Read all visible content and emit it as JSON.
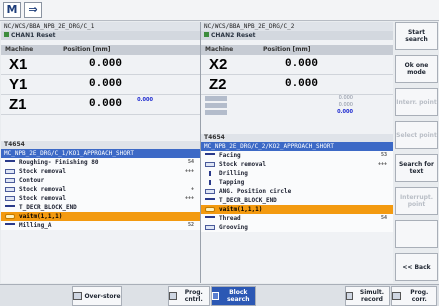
{
  "topbar": {
    "icon1": "M",
    "icon2": "⇒"
  },
  "channels": [
    {
      "path": "NC/WCS/BBA_NPB_2E_DRG/C_1",
      "status": "CHAN1 Reset",
      "axis_header": {
        "col1": "Machine",
        "col2": "Position [mm]"
      },
      "axes": [
        {
          "name": "X1",
          "value": "0.000"
        },
        {
          "name": "Y1",
          "value": "0.000"
        },
        {
          "name": "Z1",
          "value": "0.000",
          "extra": "0.000"
        }
      ],
      "t_label": "T4654",
      "program": "MC_NPB_2E_DRG/C_1/KO1_APPROACH_SHORT",
      "blocks": [
        {
          "text": "Roughing- Finishing 80",
          "right": "54"
        },
        {
          "text": "Stock removal",
          "right": "+++"
        },
        {
          "text": "Contour",
          "right": ""
        },
        {
          "text": "Stock removal",
          "right": "+"
        },
        {
          "text": "Stock removal",
          "right": "+++"
        },
        {
          "text": "T_DECR_BLOCK_END",
          "right": ""
        },
        {
          "text": "vaitm(1,1,1)",
          "right": ""
        },
        {
          "text": "Milling_A",
          "right": "52"
        }
      ],
      "highlight_index": 6
    },
    {
      "path": "NC/WCS/BBA_NPB_2E_DRG/C_2",
      "status": "CHAN2 Reset",
      "axis_header": {
        "col1": "Machine",
        "col2": "Position [mm]"
      },
      "axes": [
        {
          "name": "X2",
          "value": "0.000"
        },
        {
          "name": "Z2",
          "value": "0.000"
        }
      ],
      "minor_axes": [
        {
          "v": "0.000"
        },
        {
          "v": "0.000"
        },
        {
          "v": "0.000"
        }
      ],
      "t_label": "T4654",
      "program": "MC_NPB_2E_DRG/C_2/KO2_APPROACH_SHORT",
      "blocks": [
        {
          "text": "Facing",
          "right": "53"
        },
        {
          "text": "Stock removal",
          "right": "+++"
        },
        {
          "text": "Drilling",
          "right": ""
        },
        {
          "text": "Tapping",
          "right": ""
        },
        {
          "text": "ANG. Position circle",
          "right": ""
        },
        {
          "text": "T_DECR_BLOCK_END",
          "right": ""
        },
        {
          "text": "vaitm(1,1,1)",
          "right": ""
        },
        {
          "text": "Thread",
          "right": "54"
        },
        {
          "text": "Grooving",
          "right": ""
        }
      ],
      "highlight_index": 6
    }
  ],
  "right_softkeys": [
    {
      "label": "Start search",
      "enabled": true
    },
    {
      "label": "Ok one mode",
      "enabled": true
    },
    {
      "label": "Interr. point",
      "enabled": false
    },
    {
      "label": "Select point",
      "enabled": false
    },
    {
      "label": "Search for text",
      "enabled": true
    },
    {
      "label": "Interrupt. point",
      "enabled": false
    },
    {
      "label": "",
      "enabled": false
    },
    {
      "label": "<< Back",
      "enabled": true
    }
  ],
  "bottom_softkeys": [
    {
      "label": "Over-store",
      "active": false
    },
    {
      "label": "Prog. cntrl.",
      "active": false
    },
    {
      "label": "Block search",
      "active": true
    },
    {
      "label": "Simult. record",
      "active": false
    },
    {
      "label": "Prog. corr.",
      "active": false
    }
  ],
  "colors": {
    "highlight": "#f39a10",
    "program_bar": "#3c69c6",
    "active_softkey": "#2c58b4"
  }
}
